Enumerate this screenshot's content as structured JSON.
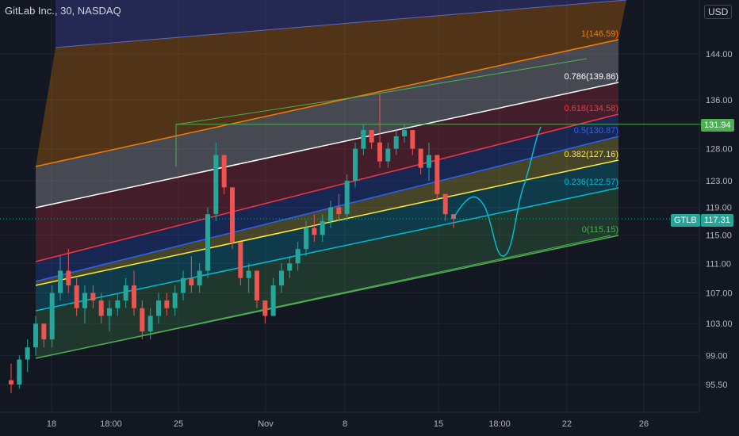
{
  "header": {
    "title": "GitLab Inc., 30, NASDAQ",
    "currency": "USD"
  },
  "price_tags": {
    "line_value": "131.94",
    "symbol": "GTLB",
    "last_price": "117.31"
  },
  "colors": {
    "background": "#131722",
    "up": "#26a69a",
    "down": "#ef5350",
    "axis_text": "#b2b5be"
  },
  "chart_data": {
    "type": "candlestick",
    "title": "GitLab Inc., 30, NASDAQ",
    "y_axis": {
      "scale": "log",
      "ticks": [
        "144.00",
        "136.00",
        "128.00",
        "123.00",
        "119.00",
        "115.00",
        "111.00",
        "107.00",
        "103.00",
        "99.00",
        "95.50"
      ],
      "tick_values": [
        144,
        136,
        128,
        123,
        119,
        115,
        111,
        107,
        103,
        99,
        95.5
      ]
    },
    "x_axis": {
      "ticks": [
        "18",
        "18:00",
        "25",
        "Nov",
        "8",
        "15",
        "18:00",
        "22",
        "26"
      ]
    },
    "fib_channel": {
      "levels": [
        {
          "ratio": "1",
          "label": "1(146.59)",
          "price": 146.59,
          "color": "#f57c00"
        },
        {
          "ratio": "0.786",
          "label": "0.786(139.86)",
          "price": 139.86,
          "color": "#ffffff"
        },
        {
          "ratio": "0.618",
          "label": "0.618(134.58)",
          "price": 134.58,
          "color": "#f23645"
        },
        {
          "ratio": "0.5",
          "label": "0.5(130.87)",
          "price": 130.87,
          "color": "#2962ff"
        },
        {
          "ratio": "0.382",
          "label": "0.382(127.16)",
          "price": 127.16,
          "color": "#ffeb3b"
        },
        {
          "ratio": "0.236",
          "label": "0.236(122.57)",
          "price": 122.57,
          "color": "#00bcd4"
        },
        {
          "ratio": "0",
          "label": "0(115.15)",
          "price": 115.15,
          "color": "#4caf50"
        }
      ]
    },
    "horizontal_line": {
      "value": 131.94,
      "color": "#4caf50"
    },
    "last_price": {
      "value": 117.31,
      "color": "#26a69a"
    },
    "candles_approx": {
      "note_free": true,
      "ohlc": [
        [
          96,
          98,
          94.5,
          95.5
        ],
        [
          95.5,
          99,
          95,
          98.5
        ],
        [
          98.5,
          101,
          97,
          100
        ],
        [
          100,
          104,
          99,
          103
        ],
        [
          103,
          102,
          100,
          101
        ],
        [
          101,
          108,
          100,
          107
        ],
        [
          107,
          112,
          106,
          110
        ],
        [
          110,
          113,
          107,
          108
        ],
        [
          108,
          109,
          104,
          105
        ],
        [
          105,
          108,
          103,
          107
        ],
        [
          107,
          108,
          105,
          106
        ],
        [
          106,
          107,
          103,
          104
        ],
        [
          104,
          106,
          102,
          105
        ],
        [
          105,
          107,
          104,
          106
        ],
        [
          106,
          109,
          105,
          108
        ],
        [
          108,
          110,
          104,
          105
        ],
        [
          105,
          106,
          101,
          102
        ],
        [
          102,
          105,
          101,
          104
        ],
        [
          104,
          107,
          103,
          106
        ],
        [
          106,
          107,
          104,
          105
        ],
        [
          105,
          108,
          104,
          107
        ],
        [
          107,
          110,
          106,
          109
        ],
        [
          109,
          112,
          107,
          108
        ],
        [
          108,
          111,
          107,
          110
        ],
        [
          110,
          119,
          109,
          118
        ],
        [
          118,
          129,
          117,
          127
        ],
        [
          127,
          125,
          121,
          122
        ],
        [
          122,
          118,
          113,
          114
        ],
        [
          114,
          112,
          108,
          109
        ],
        [
          109,
          111,
          107,
          110
        ],
        [
          110,
          109,
          105,
          106
        ],
        [
          106,
          105,
          103,
          104
        ],
        [
          104,
          109,
          104,
          108
        ],
        [
          108,
          111,
          107,
          110
        ],
        [
          110,
          112,
          109,
          111
        ],
        [
          111,
          114,
          110,
          113
        ],
        [
          113,
          117,
          112,
          116
        ],
        [
          116,
          118,
          114,
          115
        ],
        [
          115,
          118,
          114,
          117
        ],
        [
          117,
          120,
          116,
          119
        ],
        [
          119,
          121,
          117,
          118
        ],
        [
          118,
          124,
          117,
          123
        ],
        [
          123,
          129,
          122,
          128
        ],
        [
          128,
          132,
          127,
          131
        ],
        [
          131,
          130,
          128,
          129
        ],
        [
          129,
          137,
          125,
          126
        ],
        [
          126,
          129,
          125,
          128
        ],
        [
          128,
          131,
          127,
          130
        ],
        [
          130,
          132,
          129,
          131
        ],
        [
          131,
          130,
          127,
          128
        ],
        [
          128,
          127,
          124,
          125
        ],
        [
          125,
          129,
          123,
          127
        ],
        [
          127,
          126,
          120,
          121
        ],
        [
          121,
          119,
          117,
          118
        ],
        [
          118,
          118,
          116,
          117.31
        ]
      ]
    }
  }
}
